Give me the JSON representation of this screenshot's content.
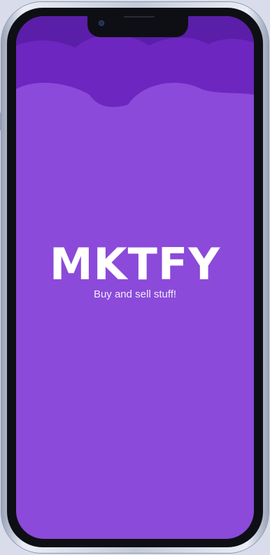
{
  "app": {
    "brand_name": "MKTFY",
    "tagline": "Buy and sell stuff!"
  },
  "colors": {
    "background": "#8b4ad9",
    "cloud_dark": "#5a1ea8",
    "cloud_mid": "#6d26bf",
    "text": "#ffffff",
    "device_frame": "#c4cad9",
    "page_background": "#d9dcea"
  },
  "icons": {
    "camera": "front-camera-icon"
  }
}
